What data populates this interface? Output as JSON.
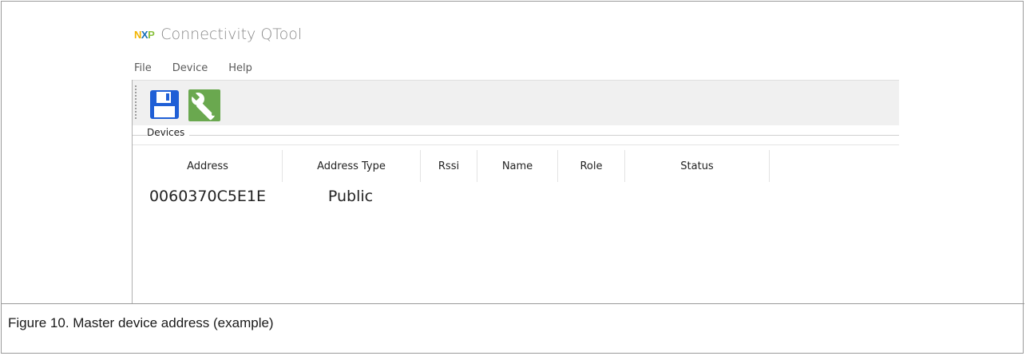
{
  "app": {
    "title": "Connectivity QTool",
    "logo_text": "NXP"
  },
  "menu": {
    "items": [
      "File",
      "Device",
      "Help"
    ]
  },
  "toolbar": {
    "save_icon": "floppy-save-icon",
    "settings_icon": "wrench-icon"
  },
  "devices_group": {
    "label": "Devices"
  },
  "table": {
    "columns": [
      "Address",
      "Address Type",
      "Rssi",
      "Name",
      "Role",
      "Status"
    ],
    "rows": [
      {
        "address": "0060370C5E1E",
        "address_type": "Public"
      }
    ]
  },
  "figure": {
    "caption": "Figure 10.  Master device address (example)"
  },
  "colors": {
    "save_blue": "#1f5fd6",
    "wrench_green": "#6aa84f",
    "logo_yellow": "#f2b400",
    "logo_blue": "#1a70b8",
    "logo_green": "#8ac13f"
  }
}
